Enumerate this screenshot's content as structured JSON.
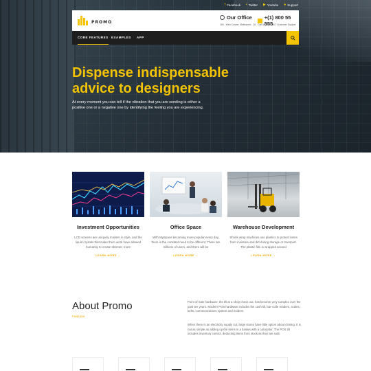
{
  "top_social": [
    {
      "icon": "facebook-icon",
      "label": "Facebook"
    },
    {
      "icon": "twitter-icon",
      "label": "Twitter"
    },
    {
      "icon": "youtube-icon",
      "label": "Youtube"
    },
    {
      "icon": "support-icon",
      "label": "Support"
    }
  ],
  "brand": {
    "name": "PROMO"
  },
  "office": {
    "title": "Our Office",
    "address": "194 - Web Conver, Melbourne - 18"
  },
  "phone": {
    "number": "+(1) 800 55 555",
    "note": "Call Us Now: 24/7 Customer Support"
  },
  "nav": [
    {
      "label": "CORE FEATURES",
      "active": true
    },
    {
      "label": "EXAMPLES",
      "active": false
    },
    {
      "label": "APP",
      "active": false
    }
  ],
  "hero": {
    "title": "Dispense indispensable advice to designers",
    "text": "At every moment you can tell if the vibration that you are sending is either a positive one or a negative one by identifying the feeling you are experiencing."
  },
  "features": [
    {
      "title": "Investment Opportunities",
      "text": "LCD screens are uniquely modern in style, and the liquid crystals that make them work have allowed humanity to create slimmer, more",
      "link": "LEARN MORE"
    },
    {
      "title": "Office Space",
      "text": "With MySpace becoming more popular every day, there is the constant need to be different. There are millions of users, and there will be",
      "link": "LEARN MORE"
    },
    {
      "title": "Warehouse Development",
      "text": "Shrink wrap machines use plastics to protect items from moisture and dirt during storage or transport. The plastic film is wrapped around",
      "link": "LEARN MORE"
    }
  ],
  "about": {
    "title": "About Promo",
    "subtitle": "Features",
    "para1": "Point of Sale hardware, the till at a shop check out, has become very complex over the past ten years. Modern POS hardware includes the cash till, bar-code readers, scales, belts, communications system and modem.",
    "para2": "When there is an electricity supply cut, large stores have little option about closing. It is not as simple as adding up the items in a basket with a calculator. The POS till includes inventory control, deducting items from stock as they are sold."
  },
  "colors": {
    "accent": "#f5c400",
    "nav_bg": "#1e1e1e"
  }
}
